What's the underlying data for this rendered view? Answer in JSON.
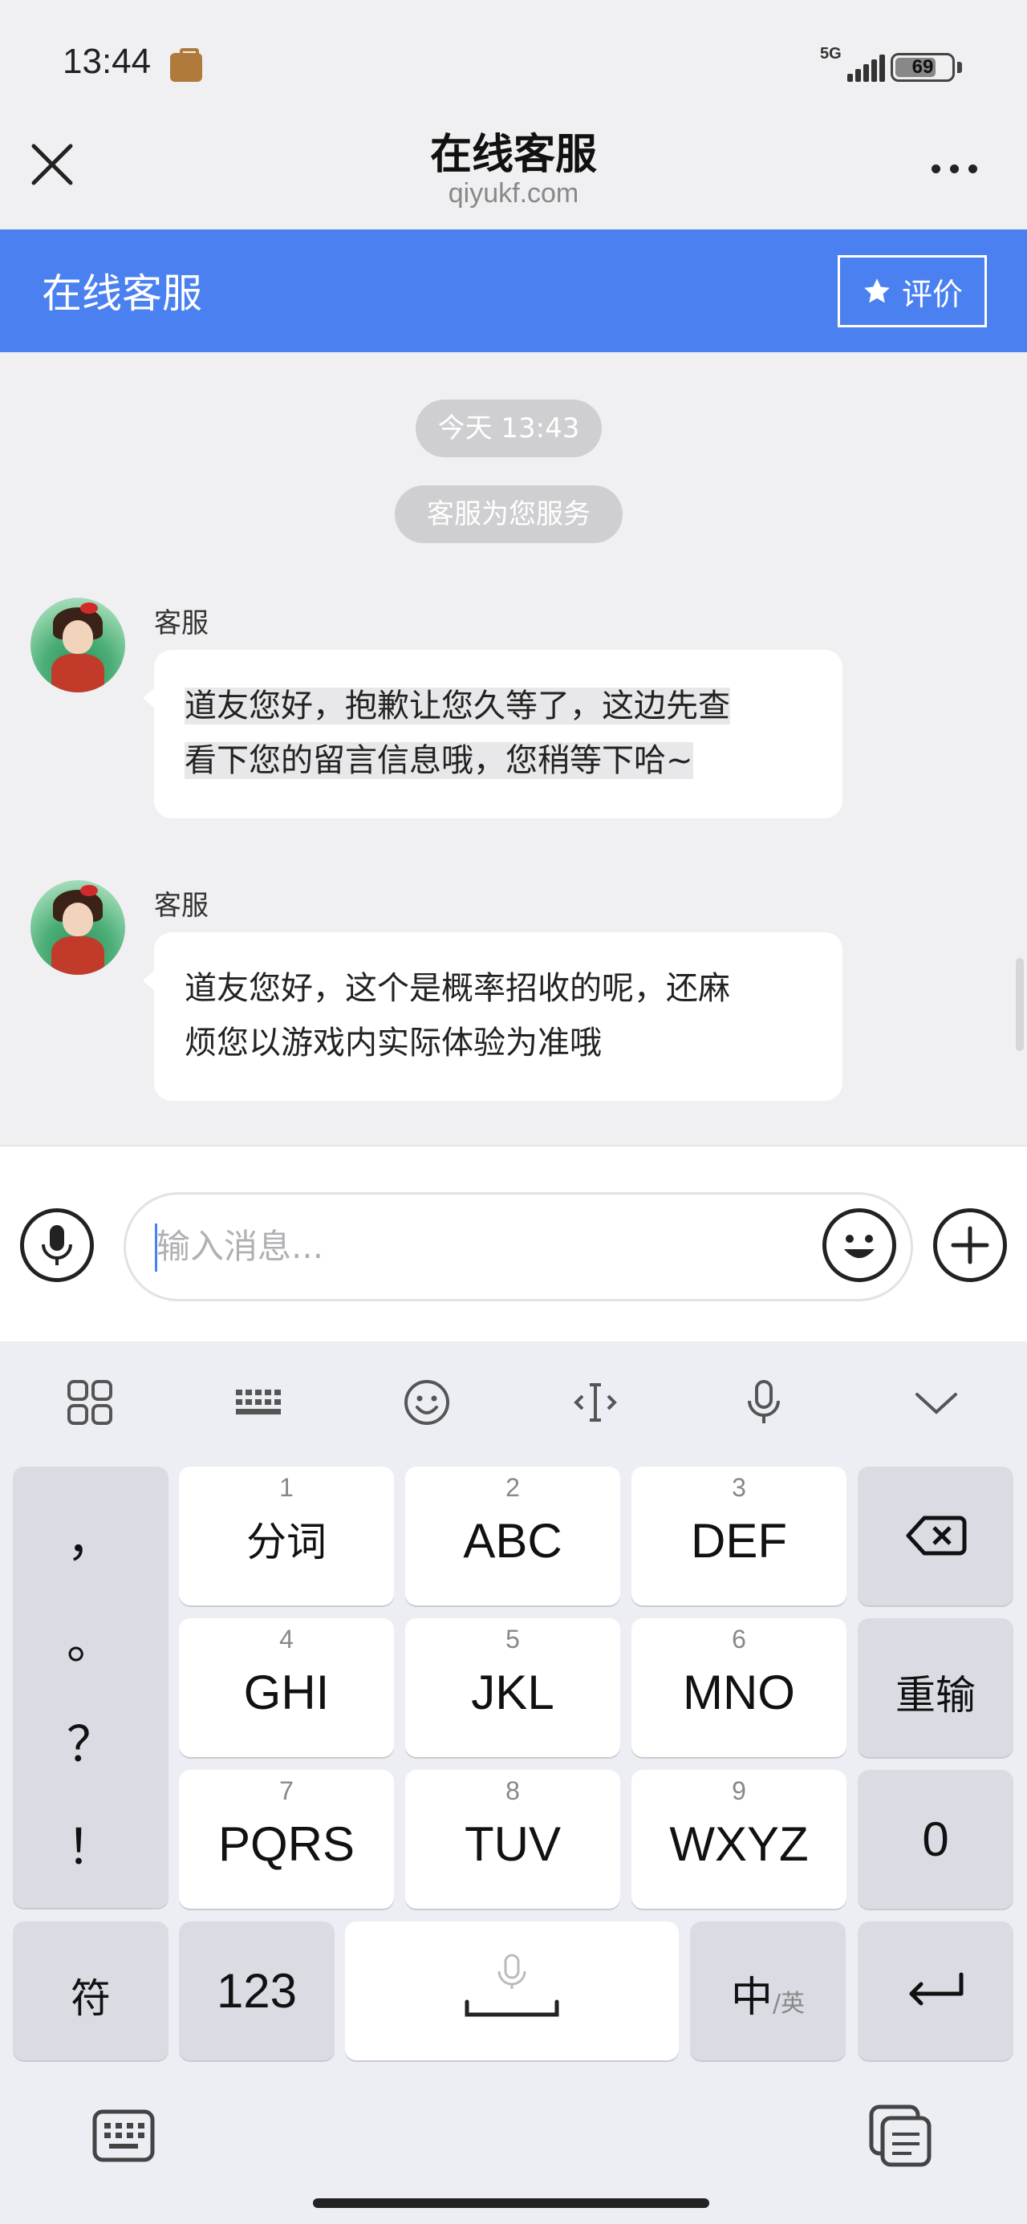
{
  "status_bar": {
    "time": "13:44",
    "network": "5G",
    "battery": "69"
  },
  "browser": {
    "title": "在线客服",
    "domain": "qiyukf.com"
  },
  "chat_header": {
    "title": "在线客服",
    "rate_label": "评价"
  },
  "chat": {
    "time_pill": "今天 13:43",
    "service_pill": "客服为您服务",
    "messages": [
      {
        "sender": "客服",
        "lines": [
          "道友您好，抱歉让您久等了，这边先查",
          "看下您的留言信息哦，您稍等下哈~"
        ]
      },
      {
        "sender": "客服",
        "lines": [
          "道友您好，这个是概率招收的呢，还麻",
          "烦您以游戏内实际体验为准哦"
        ]
      }
    ]
  },
  "input": {
    "placeholder": "输入消息..."
  },
  "keyboard": {
    "left_punct": [
      "，",
      "。",
      "？",
      "！"
    ],
    "keys": [
      {
        "num": "1",
        "label": "分词"
      },
      {
        "num": "2",
        "label": "ABC"
      },
      {
        "num": "3",
        "label": "DEF"
      },
      {
        "num": "4",
        "label": "GHI"
      },
      {
        "num": "5",
        "label": "JKL"
      },
      {
        "num": "6",
        "label": "MNO"
      },
      {
        "num": "7",
        "label": "PQRS"
      },
      {
        "num": "8",
        "label": "TUV"
      },
      {
        "num": "9",
        "label": "WXYZ"
      }
    ],
    "retype": "重输",
    "zero": "0",
    "symbols": "符",
    "numbers": "123",
    "lang_primary": "中",
    "lang_secondary": "/英"
  }
}
